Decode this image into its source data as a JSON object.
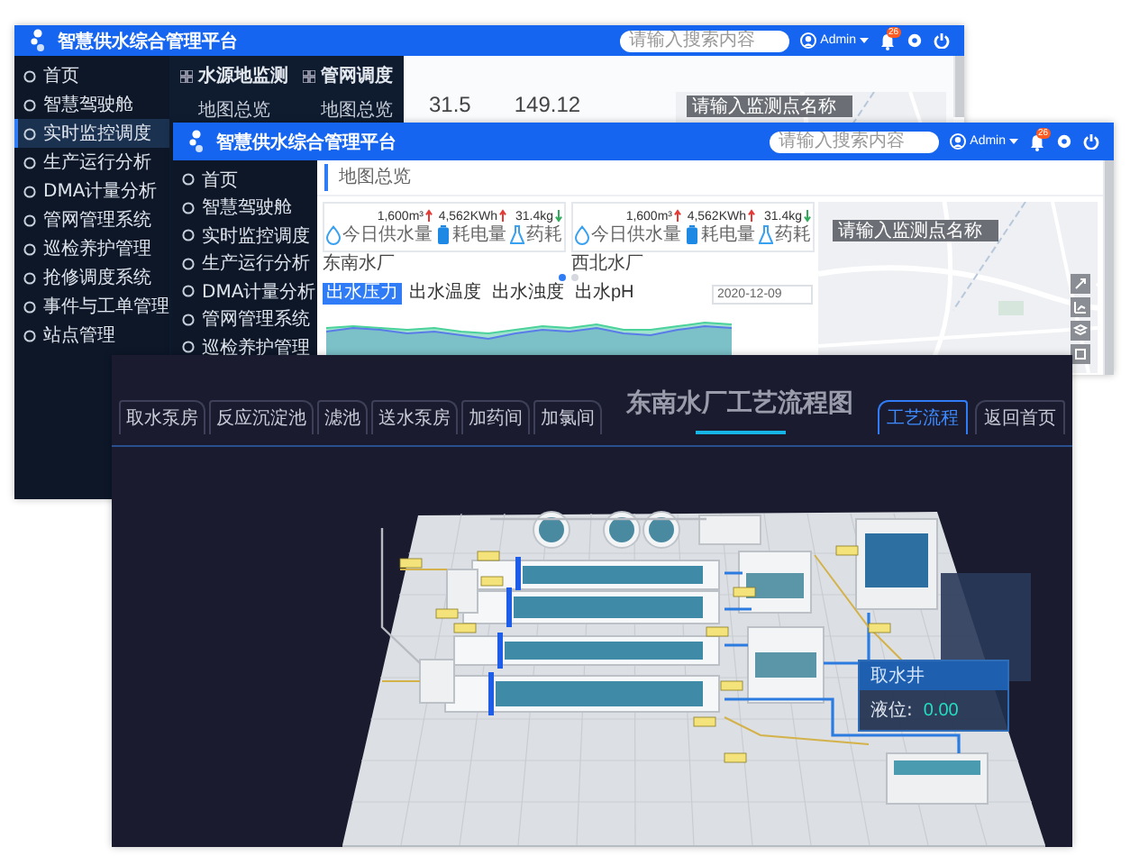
{
  "back_window": {
    "title": "智慧供水综合管理平台",
    "search_placeholder": "请输入搜索内容",
    "user": "Admin",
    "badge": "26",
    "sidebar": [
      {
        "label": "首页",
        "selected": false
      },
      {
        "label": "智慧驾驶舱",
        "selected": false
      },
      {
        "label": "实时监控调度",
        "selected": true
      },
      {
        "label": "生产运行分析",
        "selected": false
      },
      {
        "label": "DMA计量分析",
        "selected": false
      },
      {
        "label": "管网管理系统",
        "selected": false
      },
      {
        "label": "巡检养护管理",
        "selected": false
      },
      {
        "label": "抢修调度系统",
        "selected": false
      },
      {
        "label": "事件与工单管理",
        "selected": false
      },
      {
        "label": "站点管理",
        "selected": false
      }
    ],
    "submenu": [
      {
        "heading": "水源地监测",
        "items": [
          "地图总览"
        ]
      },
      {
        "heading": "管网调度",
        "items": [
          "地图总览"
        ]
      }
    ],
    "readings": [
      "31.5",
      "149.12"
    ],
    "map_search": {
      "placeholder": "请输入监测点名称"
    }
  },
  "middle_window": {
    "title": "智慧供水综合管理平台",
    "search_placeholder": "请输入搜索内容",
    "user": "Admin",
    "badge": "26",
    "sidebar": [
      {
        "label": "首页",
        "selected": false
      },
      {
        "label": "智慧驾驶舱",
        "selected": false
      },
      {
        "label": "实时监控调度",
        "selected": false
      },
      {
        "label": "生产运行分析",
        "selected": false
      },
      {
        "label": "DMA计量分析",
        "selected": false
      },
      {
        "label": "管网管理系统",
        "selected": false
      },
      {
        "label": "巡检养护管理",
        "selected": false
      }
    ],
    "breadcrumb": "地图总览",
    "plants": [
      {
        "name": "东南水厂",
        "stats": [
          {
            "kind": "drop",
            "value": "1,600m³",
            "rising": true,
            "label": "今日供水量"
          },
          {
            "kind": "battery",
            "value": "4,562KWh",
            "rising": true,
            "label": "耗电量"
          },
          {
            "kind": "flask",
            "value": "31.4kg",
            "rising": false,
            "label": "药耗"
          }
        ]
      },
      {
        "name": "西北水厂",
        "stats": [
          {
            "kind": "drop",
            "value": "1,600m³",
            "rising": true,
            "label": "今日供水量"
          },
          {
            "kind": "battery",
            "value": "4,562KWh",
            "rising": true,
            "label": "耗电量"
          },
          {
            "kind": "flask",
            "value": "31.4kg",
            "rising": false,
            "label": "药耗"
          }
        ]
      }
    ],
    "pages": [
      {
        "selected": true
      },
      {
        "selected": false
      }
    ],
    "tabs": [
      {
        "label": "出水压力",
        "selected": true
      },
      {
        "label": "出水温度",
        "selected": false
      },
      {
        "label": "出水浊度",
        "selected": false
      },
      {
        "label": "出水pH",
        "selected": false
      }
    ],
    "date": "2020-12-09",
    "map_search": {
      "placeholder": "请输入监测点名称"
    }
  },
  "front_window": {
    "tabs": [
      {
        "label": "取水泵房",
        "selected": false
      },
      {
        "label": "反应沉淀池",
        "selected": false
      },
      {
        "label": "滤池",
        "selected": false
      },
      {
        "label": "送水泵房",
        "selected": false
      },
      {
        "label": "加药间",
        "selected": false
      },
      {
        "label": "加氯间",
        "selected": false
      }
    ],
    "title": "东南水厂工艺流程图",
    "buttons": [
      {
        "label": "工艺流程",
        "selected": true
      },
      {
        "label": "返回首页",
        "selected": false
      }
    ],
    "popup": {
      "title": "取水井",
      "label": "液位:",
      "value": "0.00"
    }
  }
}
